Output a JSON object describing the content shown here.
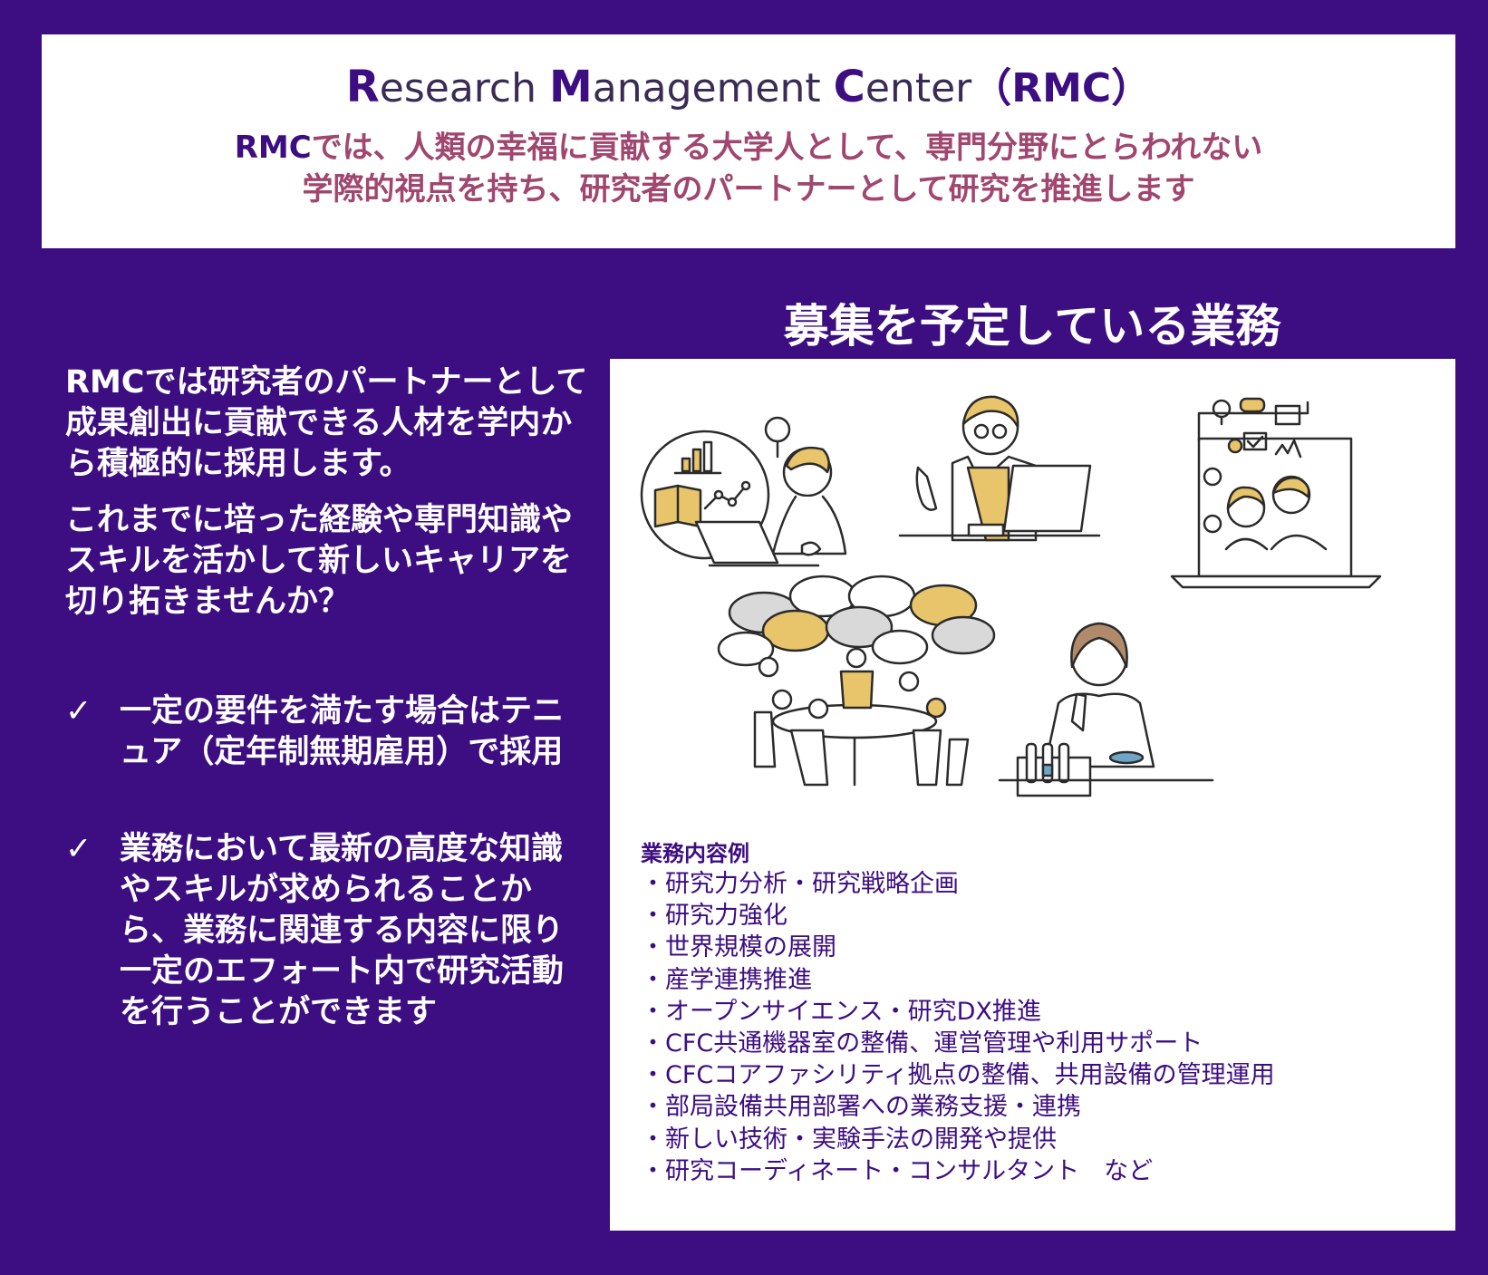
{
  "header": {
    "title_parts": [
      {
        "cap": "R",
        "rest": "esearch "
      },
      {
        "cap": "M",
        "rest": "anagement "
      },
      {
        "cap": "C",
        "rest": "enter"
      }
    ],
    "title_abbrev": "（RMC）",
    "line1_rmc": "RMC",
    "line1_rest": "では、人類の幸福に貢献する大学人として、専門分野にとらわれない",
    "line2": "学際的視点を持ち、研究者のパートナーとして研究を推進します"
  },
  "left": {
    "para1": "RMCでは研究者のパートナーとして成果創出に貢献できる人材を学内から積極的に採用します。",
    "para2": "これまでに培った経験や専門知識やスキルを活かして新しいキャリアを切り拓きませんか？",
    "checks": [
      "一定の要件を満たす場合はテニュア（定年制無期雇用）で採用",
      "業務において最新の高度な知識やスキルが求められることから、業務に関連する内容に限り一定のエフォート内で研究活動を行うことができます"
    ]
  },
  "plan_title": "募集を予定している業務",
  "examples": {
    "heading": "業務内容例",
    "items": [
      "・研究力分析・研究戦略企画",
      "・研究力強化",
      "・世界規模の展開",
      "・産学連携推進",
      "・オープンサイエンス・研究DX推進",
      "・CFC共通機器室の整備、運営管理や利用サポート",
      "・CFCコアファシリティ拠点の整備、共用設備の管理運用",
      "・部局設備共用部署への業務支援・連携",
      "・新しい技術・実験手法の開発や提供",
      "・研究コーディネート・コンサルタント　など"
    ]
  },
  "colors": {
    "background": "#3d0d82",
    "accent_text": "#a0466f",
    "illustration_yellow": "#e8c46a"
  },
  "icons": {
    "check": "checkmark-icon",
    "illustrations": [
      "data-analysis-illustration",
      "presenter-laptop-illustration",
      "online-meeting-illustration",
      "group-discussion-illustration",
      "lab-researcher-illustration"
    ]
  }
}
